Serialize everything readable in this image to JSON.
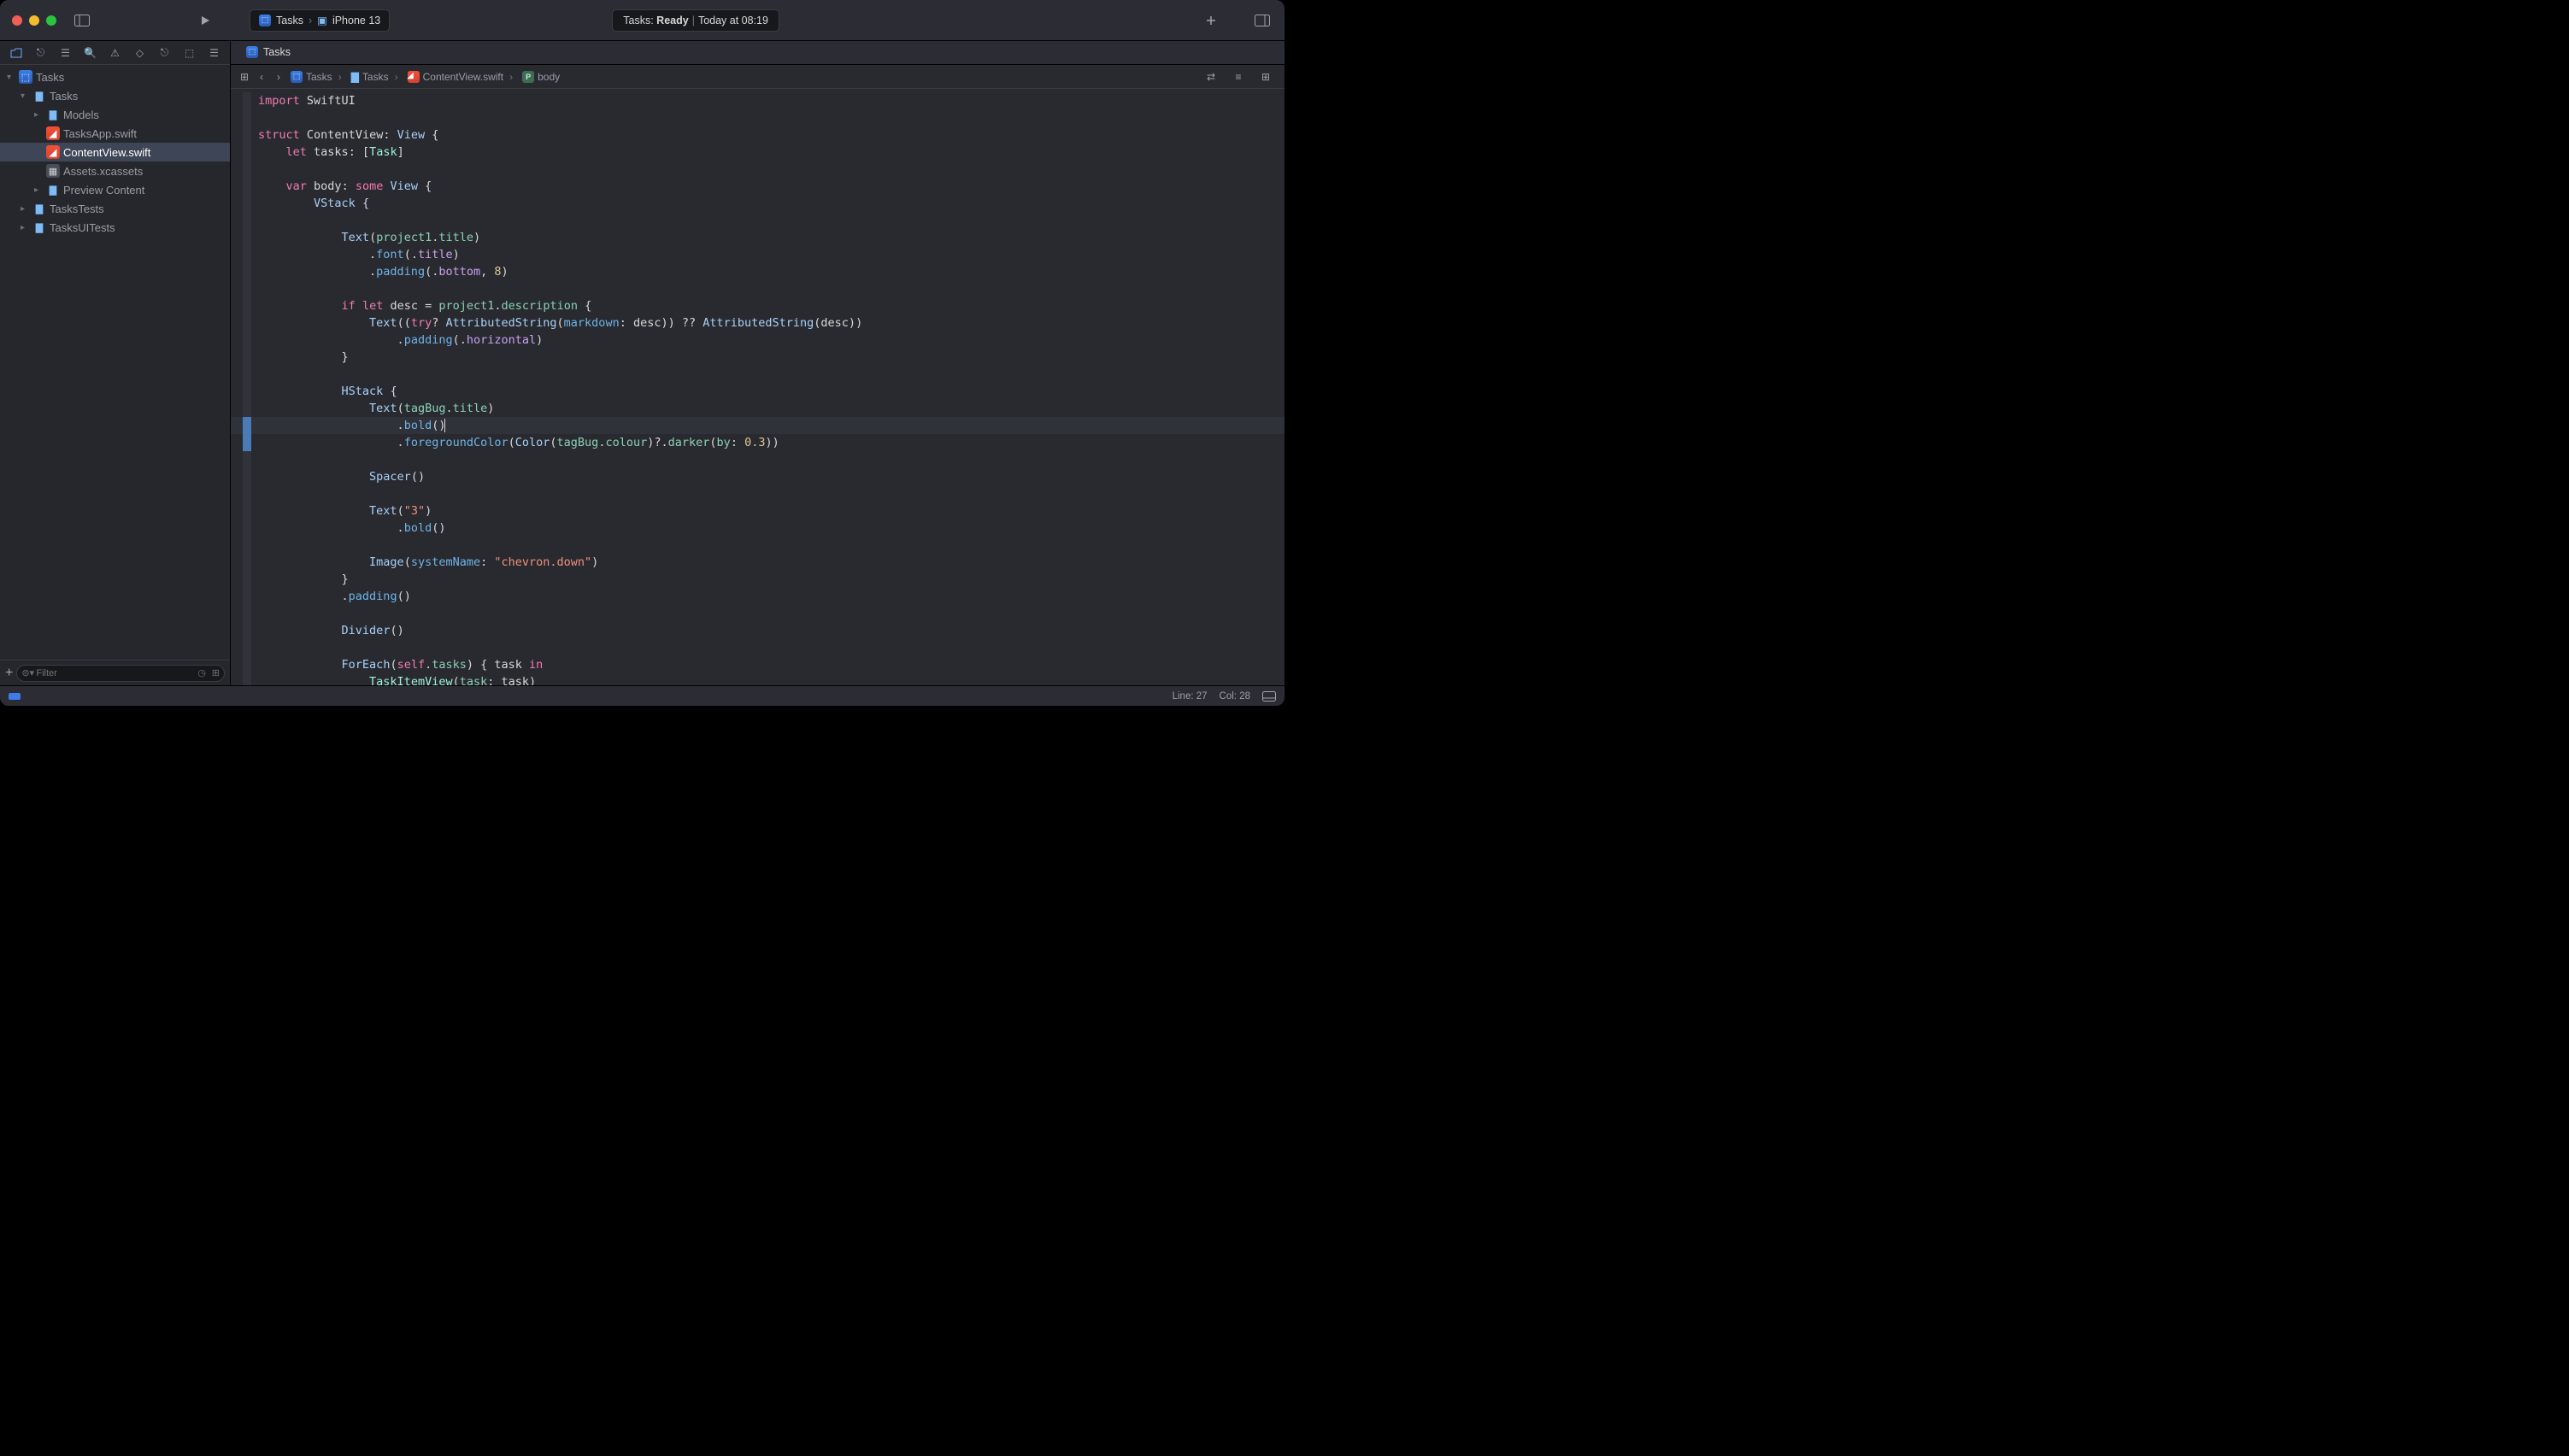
{
  "titlebar": {
    "scheme_target": "Tasks",
    "device": "iPhone 13",
    "status_prefix": "Tasks:",
    "status_state": "Ready",
    "status_time": "Today at 08:19"
  },
  "tab": {
    "active_file": "Tasks"
  },
  "navigator": {
    "filter_placeholder": "Filter",
    "tree": {
      "root": "Tasks",
      "group_app": "Tasks",
      "group_models": "Models",
      "file_tasksapp": "TasksApp.swift",
      "file_contentview": "ContentView.swift",
      "file_assets": "Assets.xcassets",
      "group_preview": "Preview Content",
      "group_tests": "TasksTests",
      "group_uitests": "TasksUITests"
    }
  },
  "jumpbar": {
    "c1": "Tasks",
    "c2": "Tasks",
    "c3": "ContentView.swift",
    "c4": "body"
  },
  "code": {
    "l1_a": "import",
    "l1_b": " SwiftUI",
    "l3_a": "struct",
    "l3_b": " ",
    "l3_c": "ContentView",
    "l3_d": ": ",
    "l3_e": "View",
    "l3_f": " {",
    "l4_a": "    ",
    "l4_b": "let",
    "l4_c": " ",
    "l4_d": "tasks",
    "l4_e": ": [",
    "l4_f": "Task",
    "l4_g": "]",
    "l6_a": "    ",
    "l6_b": "var",
    "l6_c": " ",
    "l6_d": "body",
    "l6_e": ": ",
    "l6_f": "some",
    "l6_g": " ",
    "l6_h": "View",
    "l6_i": " {",
    "l7_a": "        ",
    "l7_b": "VStack",
    "l7_c": " {",
    "l9_a": "            ",
    "l9_b": "Text",
    "l9_c": "(",
    "l9_d": "project1",
    "l9_e": ".",
    "l9_f": "title",
    "l9_g": ")",
    "l10_a": "                .",
    "l10_b": "font",
    "l10_c": "(.",
    "l10_d": "title",
    "l10_e": ")",
    "l11_a": "                .",
    "l11_b": "padding",
    "l11_c": "(.",
    "l11_d": "bottom",
    "l11_e": ", ",
    "l11_f": "8",
    "l11_g": ")",
    "l13_a": "            ",
    "l13_b": "if",
    "l13_c": " ",
    "l13_d": "let",
    "l13_e": " desc = ",
    "l13_f": "project1",
    "l13_g": ".",
    "l13_h": "description",
    "l13_i": " {",
    "l14_a": "                ",
    "l14_b": "Text",
    "l14_c": "((",
    "l14_d": "try",
    "l14_e": "? ",
    "l14_f": "AttributedString",
    "l14_g": "(",
    "l14_h": "markdown",
    "l14_i": ": desc)) ?? ",
    "l14_j": "AttributedString",
    "l14_k": "(desc))",
    "l15_a": "                    .",
    "l15_b": "padding",
    "l15_c": "(.",
    "l15_d": "horizontal",
    "l15_e": ")",
    "l16_a": "            }",
    "l18_a": "            ",
    "l18_b": "HStack",
    "l18_c": " {",
    "l19_a": "                ",
    "l19_b": "Text",
    "l19_c": "(",
    "l19_d": "tagBug",
    "l19_e": ".",
    "l19_f": "title",
    "l19_g": ")",
    "l20_a": "                    .",
    "l20_b": "bold",
    "l20_c": "()",
    "l21_a": "                    .",
    "l21_b": "foregroundColor",
    "l21_c": "(",
    "l21_d": "Color",
    "l21_e": "(",
    "l21_f": "tagBug",
    "l21_g": ".",
    "l21_h": "colour",
    "l21_i": ")?.",
    "l21_j": "darker",
    "l21_k": "(",
    "l21_l": "by",
    "l21_m": ": ",
    "l21_n": "0.3",
    "l21_o": "))",
    "l23_a": "                ",
    "l23_b": "Spacer",
    "l23_c": "()",
    "l25_a": "                ",
    "l25_b": "Text",
    "l25_c": "(",
    "l25_d": "\"3\"",
    "l25_e": ")",
    "l26_a": "                    .",
    "l26_b": "bold",
    "l26_c": "()",
    "l28_a": "                ",
    "l28_b": "Image",
    "l28_c": "(",
    "l28_d": "systemName",
    "l28_e": ": ",
    "l28_f": "\"chevron.down\"",
    "l28_g": ")",
    "l29_a": "            }",
    "l30_a": "            .",
    "l30_b": "padding",
    "l30_c": "()",
    "l32_a": "            ",
    "l32_b": "Divider",
    "l32_c": "()",
    "l34_a": "            ",
    "l34_b": "ForEach",
    "l34_c": "(",
    "l34_d": "self",
    "l34_e": ".",
    "l34_f": "tasks",
    "l34_g": ") { task ",
    "l34_h": "in",
    "l35_a": "                ",
    "l35_b": "TaskItemView",
    "l35_c": "(",
    "l35_d": "task",
    "l35_e": ": task)"
  },
  "statusbar": {
    "line_label": "Line:",
    "line_val": "27",
    "col_label": "Col:",
    "col_val": "28"
  }
}
